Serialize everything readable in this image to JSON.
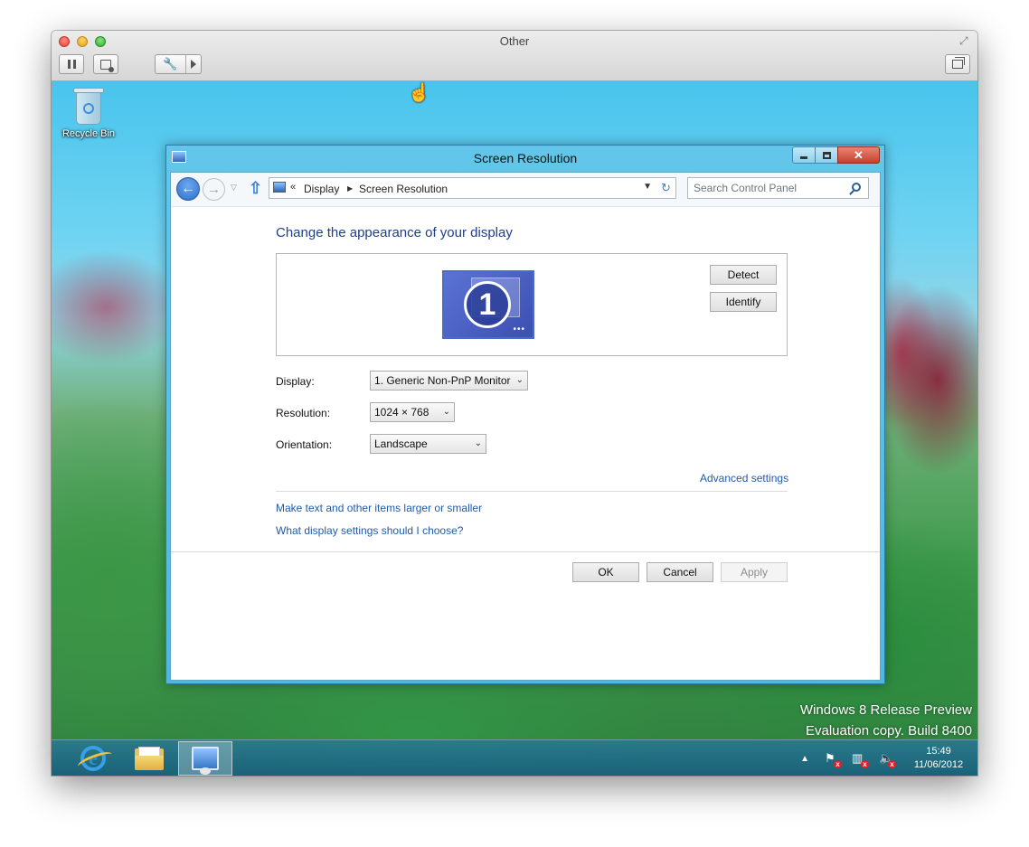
{
  "host": {
    "title": "Other"
  },
  "desktop": {
    "recycle_bin_label": "Recycle Bin",
    "watermark": {
      "line1": "Windows 8 Release Preview",
      "line2": "Evaluation copy. Build 8400"
    }
  },
  "dialog": {
    "title": "Screen Resolution",
    "address": {
      "crumbs": [
        "Display",
        "Screen Resolution"
      ],
      "search_placeholder": "Search Control Panel"
    },
    "heading": "Change the appearance of your display",
    "monitor_number": "1",
    "buttons": {
      "detect": "Detect",
      "identify": "Identify",
      "ok": "OK",
      "cancel": "Cancel",
      "apply": "Apply"
    },
    "fields": {
      "display_label": "Display:",
      "display_value": "1. Generic Non-PnP Monitor",
      "resolution_label": "Resolution:",
      "resolution_value": "1024 × 768",
      "orientation_label": "Orientation:",
      "orientation_value": "Landscape"
    },
    "links": {
      "advanced": "Advanced settings",
      "text_size": "Make text and other items larger or smaller",
      "which_settings": "What display settings should I choose?"
    }
  },
  "taskbar": {
    "clock_time": "15:49",
    "clock_date": "11/06/2012"
  },
  "colors": {
    "link": "#1f5bab",
    "heading": "#1e3f8c",
    "close_button": "#c7402e",
    "titlebar": "#62c6ea"
  }
}
